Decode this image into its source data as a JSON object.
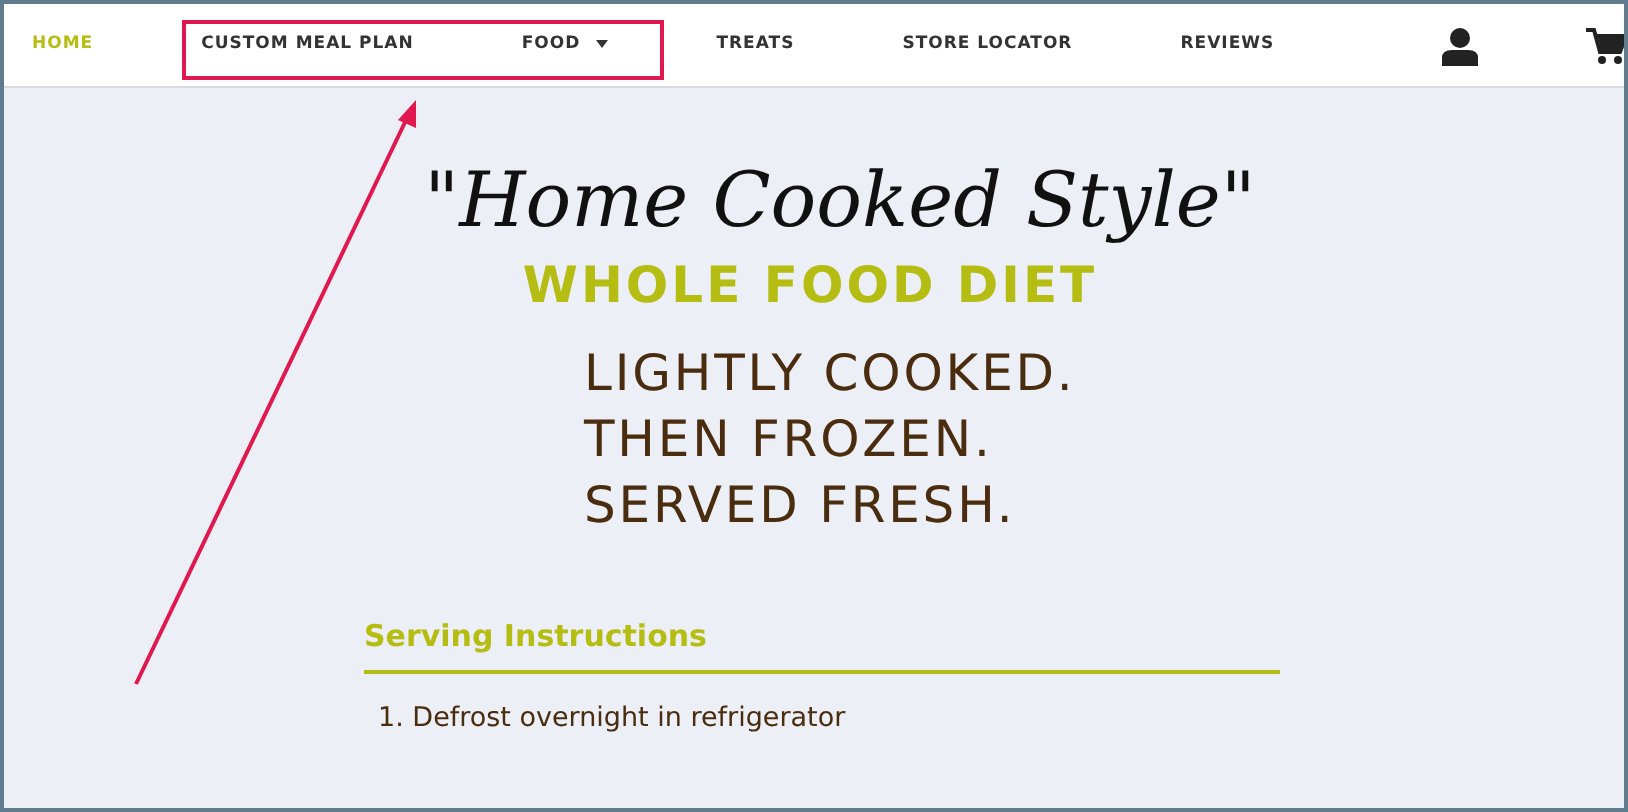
{
  "nav": {
    "items": [
      {
        "label": "HOME",
        "kind": "link",
        "selected": true
      },
      {
        "label": "CUSTOM MEAL PLAN",
        "kind": "link",
        "selected": false
      },
      {
        "label": "FOOD",
        "kind": "dropdown",
        "selected": false
      },
      {
        "label": "TREATS",
        "kind": "link",
        "selected": false
      },
      {
        "label": "STORE LOCATOR",
        "kind": "link",
        "selected": false
      },
      {
        "label": "REVIEWS",
        "kind": "link",
        "selected": false
      }
    ]
  },
  "hero": {
    "script_title": "\"Home Cooked Style\"",
    "subtitle": "WHOLE FOOD DIET",
    "lines": [
      "LIGHTLY COOKED.",
      "THEN FROZEN.",
      "SERVED FRESH."
    ]
  },
  "instructions": {
    "heading": "Serving Instructions",
    "steps": [
      {
        "number": "1.",
        "text": "Defrost overnight in refrigerator"
      }
    ]
  }
}
